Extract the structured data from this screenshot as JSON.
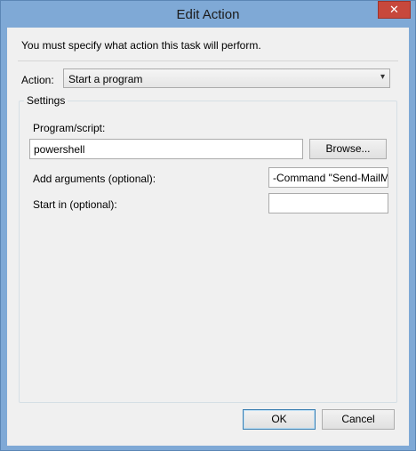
{
  "window": {
    "title": "Edit Action",
    "close_glyph": "✕"
  },
  "prompt": "You must specify what action this task will perform.",
  "action": {
    "label": "Action:",
    "selected": "Start a program"
  },
  "settings": {
    "group_title": "Settings",
    "program_label": "Program/script:",
    "program_value": "powershell",
    "browse_label": "Browse...",
    "arguments_label": "Add arguments (optional):",
    "arguments_value": "-Command \"Send-MailMessage",
    "start_in_label": "Start in (optional):",
    "start_in_value": ""
  },
  "buttons": {
    "ok": "OK",
    "cancel": "Cancel"
  },
  "colors": {
    "frame": "#7FA9D6",
    "close": "#C7483C",
    "client": "#F0F0F0"
  }
}
